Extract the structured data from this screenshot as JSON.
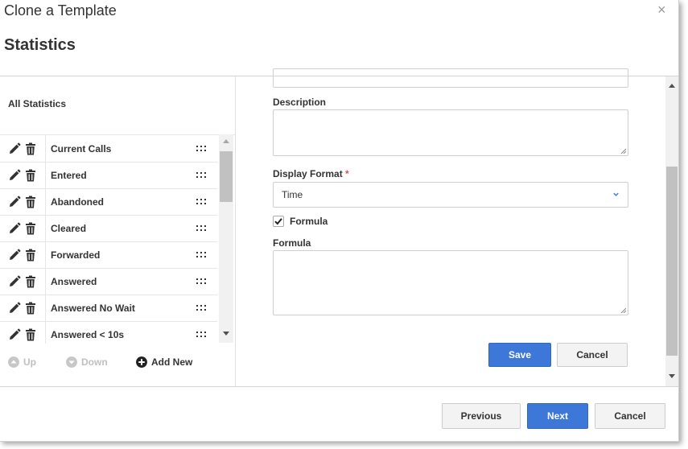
{
  "dialog": {
    "title": "Clone a Template",
    "close_label": "×"
  },
  "section": {
    "title": "Statistics"
  },
  "left_panel": {
    "heading": "All Statistics",
    "items": [
      {
        "label": "Current Calls"
      },
      {
        "label": "Entered"
      },
      {
        "label": "Abandoned"
      },
      {
        "label": "Cleared"
      },
      {
        "label": "Forwarded"
      },
      {
        "label": "Answered"
      },
      {
        "label": "Answered No Wait"
      },
      {
        "label": "Answered < 10s"
      }
    ],
    "footer": {
      "up": "Up",
      "down": "Down",
      "add_new": "Add New"
    }
  },
  "form": {
    "description_label": "Description",
    "display_format_label": "Display Format",
    "required_marker": "*",
    "display_format_value": "Time",
    "formula_checkbox_label": "Formula",
    "formula_checked": true,
    "formula_label": "Formula",
    "save": "Save",
    "cancel": "Cancel"
  },
  "wizard": {
    "previous": "Previous",
    "next": "Next",
    "cancel": "Cancel"
  },
  "colors": {
    "primary": "#3d78d8",
    "required": "#d9534f"
  },
  "icons": [
    "pencil-icon",
    "trash-icon",
    "drag-handle-icon",
    "close-icon",
    "chevron-down-icon",
    "checkmark-icon",
    "arrow-up-circle-icon",
    "arrow-down-circle-icon",
    "plus-circle-icon"
  ]
}
